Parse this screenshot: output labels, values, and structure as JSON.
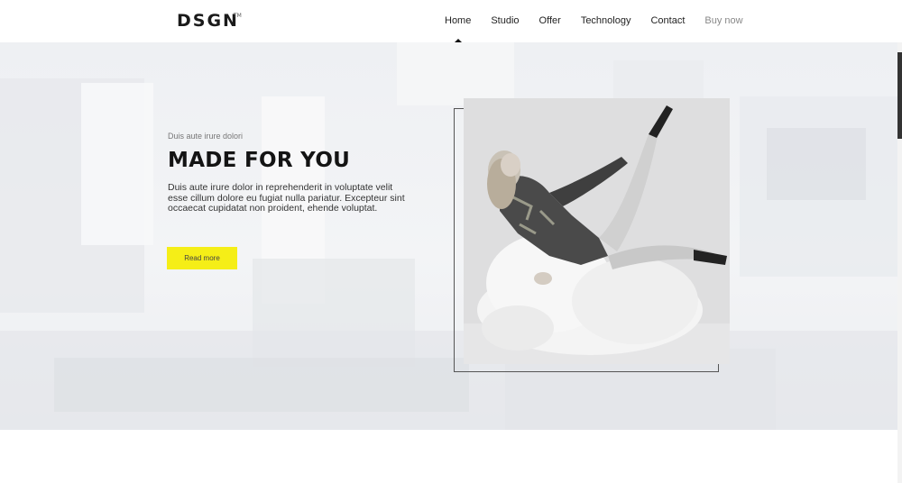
{
  "brand": {
    "logo": "DSGN",
    "logo_sup": "TM"
  },
  "nav": {
    "items": [
      {
        "label": "Home"
      },
      {
        "label": "Studio"
      },
      {
        "label": "Offer"
      },
      {
        "label": "Technology"
      },
      {
        "label": "Contact"
      },
      {
        "label": "Buy now"
      }
    ],
    "active": "Home"
  },
  "hero": {
    "eyebrow": "Duis aute irure dolori",
    "title": "MADE FOR YOU",
    "body": "Duis aute irure dolor in reprehenderit in voluptate velit esse cillum dolore eu fugiat nulla pariatur. Excepteur sint occaecat cupidatat non proident, ehende voluptat.",
    "cta_label": "Read more"
  },
  "colors": {
    "accent": "#f5ee17",
    "text_dark": "#141414",
    "nav_muted": "#888888"
  }
}
